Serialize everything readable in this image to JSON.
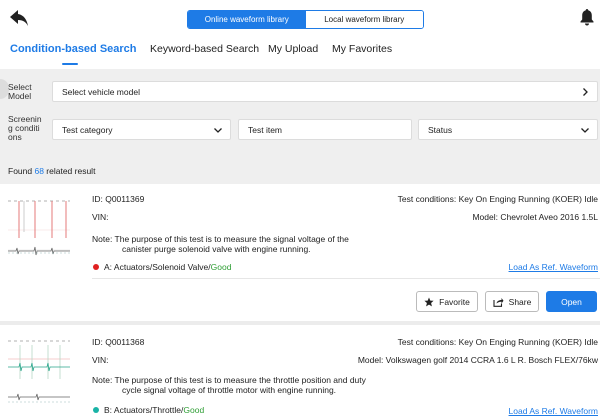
{
  "header": {
    "seg_online": "Online waveform library",
    "seg_local": "Local waveform library"
  },
  "tabs": [
    "Condition-based Search",
    "Keyword-based Search",
    "My Upload",
    "My Favorites"
  ],
  "filters": {
    "model_label": [
      "Select",
      "Model"
    ],
    "model_value": "Select vehicle model",
    "screening_label": [
      "Screenin",
      "g conditi",
      "ons"
    ],
    "category": "Test category",
    "item": "Test item",
    "status": "Status"
  },
  "found": {
    "prefix": "Found ",
    "count": "68",
    "suffix": " related result"
  },
  "results": [
    {
      "id": "ID: Q0011369",
      "conditions": "Test conditions: Key On Enging Running (KOER) Idle",
      "vin": "VIN:",
      "model": "Model: Chevrolet Aveo 2016 1.5L",
      "note_line1": "Note: The purpose of this test is to measure the signal voltage of the",
      "note_line2": "canister purge solenoid valve with engine running.",
      "channel": "A: Actuators/Solenoid Valve/",
      "status": "Good",
      "load_link": "Load As Ref. Waveform",
      "favorite": "Favorite",
      "share": "Share",
      "open": "Open"
    },
    {
      "id": "ID: Q0011368",
      "conditions": "Test conditions: Key On Enging Running (KOER) Idle",
      "vin": "VIN:",
      "model": "Model: Volkswagen golf 2014 CCRA 1.6 L R. Bosch FLEX/76kw",
      "note_line1": "Note: The purpose of this test is to measure the throttle position and duty",
      "note_line2": "cycle signal voltage of throttle motor with engine running.",
      "channel": "B: Actuators/Throttle/",
      "status": "Good",
      "load_link": "Load As Ref. Waveform"
    }
  ],
  "colors": {
    "accent": "#1e7be6",
    "good": "#2e9e34",
    "dot_a": "#e02020",
    "dot_b": "#19b3a6"
  }
}
